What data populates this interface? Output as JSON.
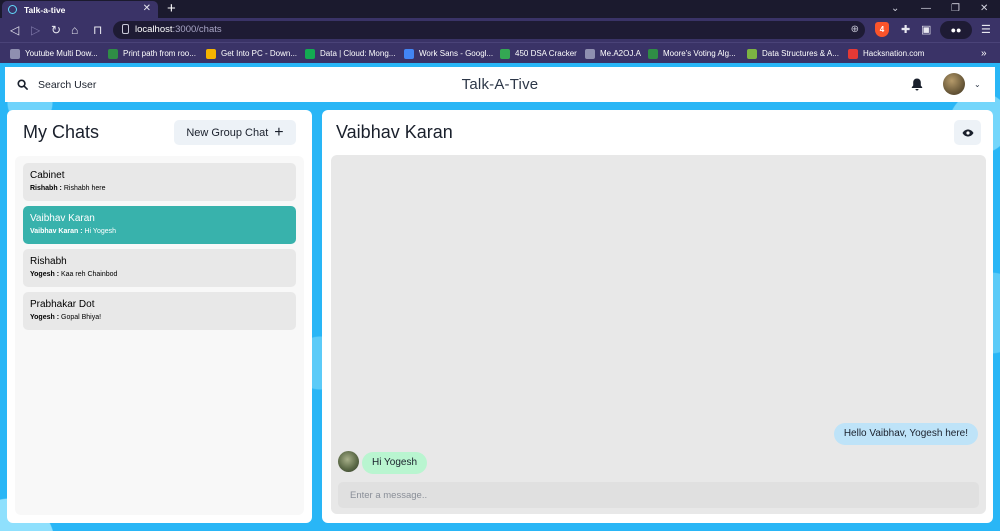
{
  "browser": {
    "tab_title": "Talk-a-tive",
    "url_host": "localhost",
    "url_path": ":3000/chats",
    "shield_count": "4",
    "bookmarks": [
      {
        "label": "Youtube Multi Dow...",
        "icon": "globe-icon",
        "color": "#8f8fb0"
      },
      {
        "label": "Print path from roo...",
        "icon": "gfg-icon",
        "color": "#2f8d46"
      },
      {
        "label": "Get Into PC - Down...",
        "icon": "g-icon",
        "color": "#f5b400"
      },
      {
        "label": "Data | Cloud: Mong...",
        "icon": "mongodb-leaf-icon",
        "color": "#13aa52"
      },
      {
        "label": "Work Sans - Googl...",
        "icon": "google-fonts-icon",
        "color": "#4285f4"
      },
      {
        "label": "450 DSA Cracker",
        "icon": "four-icon",
        "color": "#34a853"
      },
      {
        "label": "Me.A2OJ.A",
        "icon": "globe-icon",
        "color": "#8f8fb0"
      },
      {
        "label": "Moore's Voting Alg...",
        "icon": "gfg-icon",
        "color": "#2f8d46"
      },
      {
        "label": "Data Structures & A...",
        "icon": "check-badge-icon",
        "color": "#7cb342"
      },
      {
        "label": "Hacksnation.com",
        "icon": "hacksnation-icon",
        "color": "#e53935"
      }
    ]
  },
  "header": {
    "search_label": "Search User",
    "app_title": "Talk-A-Tive"
  },
  "chats": {
    "title": "My Chats",
    "new_group_label": "New Group Chat",
    "items": [
      {
        "name": "Cabinet",
        "sender": "Rishabh :",
        "message": "Rishabh here",
        "active": false
      },
      {
        "name": "Vaibhav Karan",
        "sender": "Vaibhav Karan :",
        "message": "Hi Yogesh",
        "active": true
      },
      {
        "name": "Rishabh",
        "sender": "Yogesh :",
        "message": "Kaa reh Chainbod",
        "active": false
      },
      {
        "name": "Prabhakar Dot",
        "sender": "Yogesh :",
        "message": "Gopal Bhiya!",
        "active": false
      }
    ]
  },
  "conversation": {
    "title": "Vaibhav Karan",
    "messages": [
      {
        "text": "Hello Vaibhav, Yogesh here!",
        "direction": "sent"
      },
      {
        "text": "Hi Yogesh",
        "direction": "received"
      }
    ],
    "input_placeholder": "Enter a message.."
  },
  "colors": {
    "active_chat": "#38b2ac",
    "sent_bubble": "#bee3f8",
    "received_bubble": "#b9f5d0",
    "background": "#29b6f6"
  }
}
